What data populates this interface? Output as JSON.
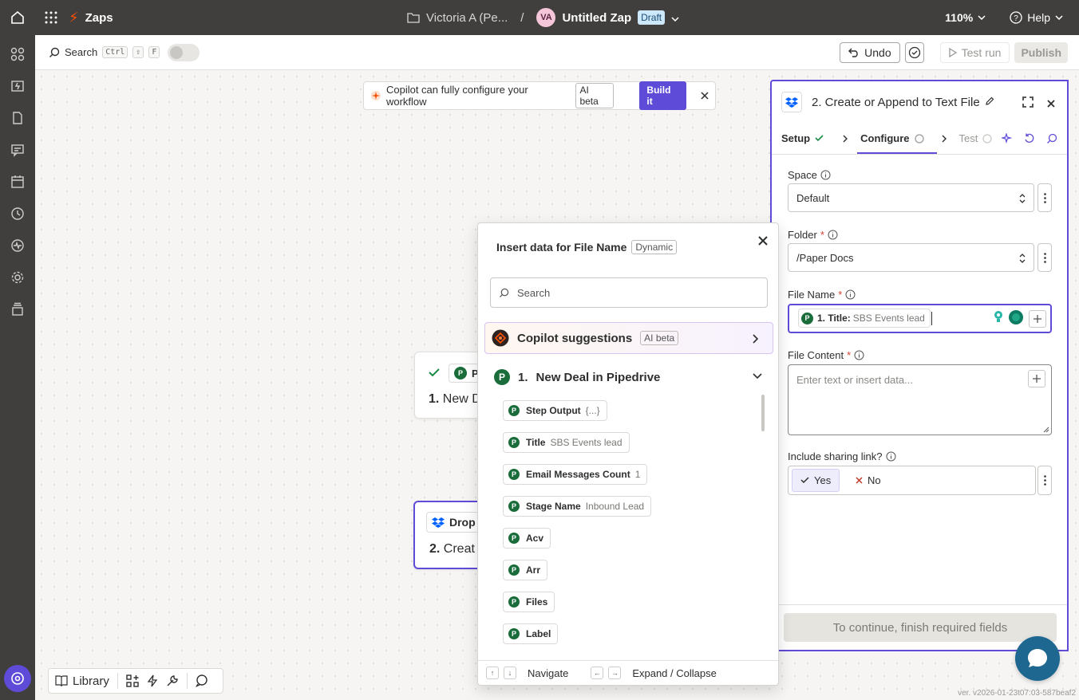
{
  "topbar": {
    "app_name": "Zaps",
    "folder": "Victoria A (Pe...",
    "separator": "/",
    "avatar_initials": "VA",
    "zap_name": "Untitled Zap",
    "status_badge": "Draft",
    "zoom": "110%",
    "help": "Help"
  },
  "subbar": {
    "search_label": "Search",
    "shortcut_ctrl": "Ctrl",
    "shortcut_shift": "⇧",
    "shortcut_f": "F",
    "undo": "Undo",
    "test_run": "Test run",
    "publish": "Publish"
  },
  "banner": {
    "text": "Copilot can fully configure your workflow",
    "badge": "AI beta",
    "button": "Build it"
  },
  "canvas": {
    "node1_app": "P",
    "node1_title_prefix": "1.",
    "node1_title": "New D",
    "node2_app": "Drop",
    "node2_title_prefix": "2.",
    "node2_title": "Creat"
  },
  "panel": {
    "title": "2. Create or Append to Text File",
    "tabs": {
      "setup": "Setup",
      "configure": "Configure",
      "test": "Test"
    },
    "space": {
      "label": "Space",
      "value": "Default"
    },
    "folder": {
      "label": "Folder",
      "required": "*",
      "value": "/Paper Docs"
    },
    "file_name": {
      "label": "File Name",
      "required": "*",
      "token_label": "1. Title:",
      "token_value": "SBS Events lead"
    },
    "file_content": {
      "label": "File Content",
      "required": "*",
      "placeholder": "Enter text or insert data..."
    },
    "sharing": {
      "label": "Include sharing link?",
      "yes": "Yes",
      "no": "No"
    },
    "continue": "To continue, finish required fields"
  },
  "popup": {
    "title": "Insert data for File Name",
    "badge": "Dynamic",
    "search_placeholder": "Search",
    "copilot": {
      "label": "Copilot suggestions",
      "badge": "AI beta"
    },
    "section": {
      "number": "1.",
      "title": "New Deal in Pipedrive"
    },
    "items": [
      {
        "name": "Step Output",
        "value": "{...}"
      },
      {
        "name": "Title",
        "value": "SBS Events lead"
      },
      {
        "name": "Email Messages Count",
        "value": "1"
      },
      {
        "name": "Stage Name",
        "value": "Inbound Lead"
      },
      {
        "name": "Acv",
        "value": ""
      },
      {
        "name": "Arr",
        "value": ""
      },
      {
        "name": "Files",
        "value": ""
      },
      {
        "name": "Label",
        "value": ""
      }
    ],
    "footer": {
      "navigate": "Navigate",
      "expand": "Expand / Collapse"
    }
  },
  "bottombar": {
    "library": "Library"
  },
  "version": "ver. v2026-01-23t07:03-587beaf2",
  "colors": {
    "accent": "#5e4bd8",
    "topbar": "#403f3e",
    "pipedrive": "#1a6d3a",
    "dropbox": "#0061fe",
    "zapier_orange": "#ff4f00"
  }
}
